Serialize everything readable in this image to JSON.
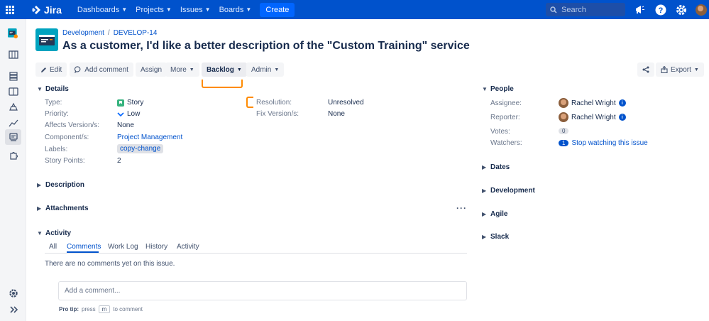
{
  "nav": {
    "brand": "Jira",
    "items": [
      "Dashboards",
      "Projects",
      "Issues",
      "Boards"
    ],
    "create": "Create",
    "search_placeholder": "Search"
  },
  "breadcrumb": {
    "project": "Development",
    "issue_key": "DEVELOP-14"
  },
  "title": "As a customer, I'd like a better description of the \"Custom Training\" service",
  "toolbar": {
    "edit": "Edit",
    "add_comment": "Add comment",
    "assign": "Assign",
    "more": "More",
    "backlog": "Backlog",
    "admin": "Admin",
    "export": "Export"
  },
  "details": {
    "heading": "Details",
    "type_label": "Type:",
    "type_value": "Story",
    "priority_label": "Priority:",
    "priority_value": "Low",
    "affects_label": "Affects Version/s:",
    "affects_value": "None",
    "components_label": "Component/s:",
    "components_value": "Project Management",
    "labels_label": "Labels:",
    "labels_value": "copy-change",
    "points_label": "Story Points:",
    "points_value": "2",
    "resolution_label": "Resolution:",
    "resolution_value": "Unresolved",
    "fix_label": "Fix Version/s:",
    "fix_value": "None"
  },
  "sections": {
    "description": "Description",
    "attachments": "Attachments",
    "activity": "Activity"
  },
  "activity": {
    "tabs": [
      "All",
      "Comments",
      "Work Log",
      "History",
      "Activity"
    ],
    "empty": "There are no comments yet on this issue.",
    "comment_placeholder": "Add a comment...",
    "protip_label": "Pro tip:",
    "protip_press": "press",
    "protip_key": "m",
    "protip_suffix": "to comment"
  },
  "people": {
    "heading": "People",
    "assignee_label": "Assignee:",
    "assignee": "Rachel Wright",
    "reporter_label": "Reporter:",
    "reporter": "Rachel Wright",
    "votes_label": "Votes:",
    "votes": "0",
    "watchers_label": "Watchers:",
    "watchers_count": "1",
    "watch_link": "Stop watching this issue"
  },
  "right_sections": [
    "Dates",
    "Development",
    "Agile",
    "Slack"
  ],
  "colors": {
    "nav_blue": "#0052cc",
    "highlight_orange": "#ff8b00",
    "story_green": "#36b37e"
  }
}
